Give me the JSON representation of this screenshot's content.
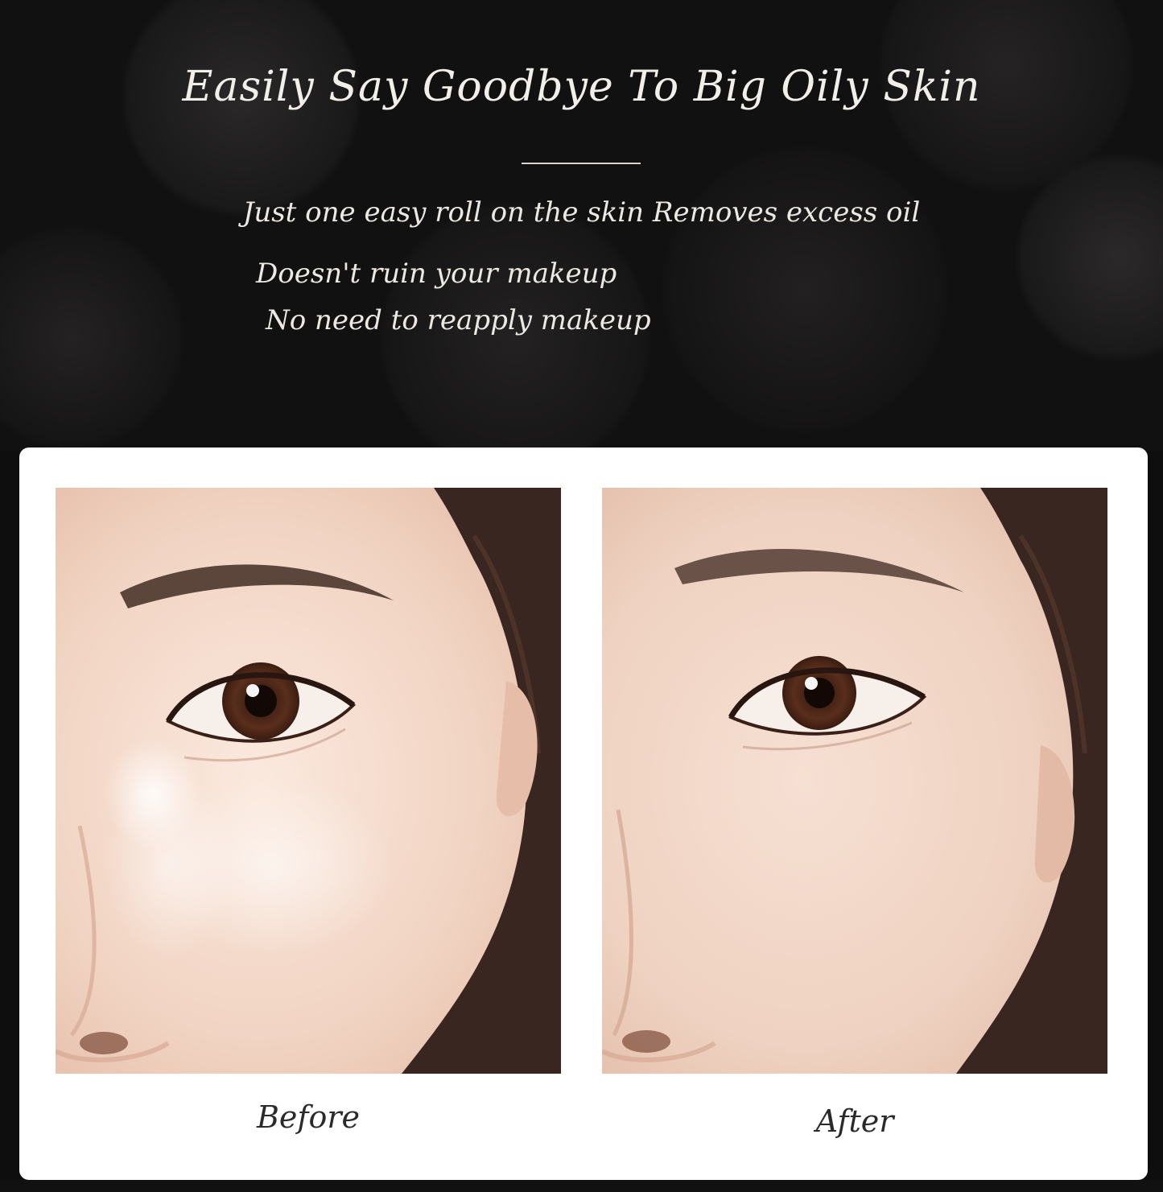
{
  "hero": {
    "title": "Easily Say Goodbye To Big Oily Skin",
    "line1": "Just one easy roll on the skin Removes excess oil",
    "line2": "Doesn't ruin your makeup",
    "line3": "No need to reapply makeup"
  },
  "comparison": {
    "before_label": "Before",
    "after_label": "After"
  },
  "colors": {
    "background": "#121111",
    "card": "#ffffff",
    "skin": "#f2d8c8",
    "hair": "#3a2620"
  }
}
